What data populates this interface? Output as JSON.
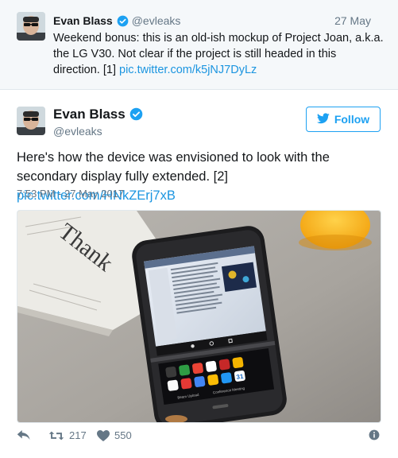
{
  "parent_tweet": {
    "name": "Evan Blass",
    "handle": "@evleaks",
    "date": "27 May",
    "text": "Weekend bonus: this is an old-ish mockup of Project Joan, a.k.a. the LG V30. Not clear if the project is still headed in this direction. [1] ",
    "link": "pic.twitter.com/k5jNJ7DyLz"
  },
  "main_tweet": {
    "name": "Evan Blass",
    "handle": "@evleaks",
    "follow_label": "Follow",
    "text": "Here's how the device was envisioned to look with the secondary display fully extended. [2] ",
    "link": "pic.twitter.com/HNkZErj7xB",
    "timestamp": "7:53 PM - 27 May 2017"
  },
  "media": {
    "newspaper_text": "Thank",
    "secondary_screen_labels": [
      "Beam Upload",
      "Conference Meeting"
    ],
    "calendar_day": "31"
  },
  "actions": {
    "retweet_count": "217",
    "like_count": "550"
  },
  "icons": [
    "verified-badge-icon",
    "twitter-bird-icon",
    "reply-icon",
    "retweet-icon",
    "heart-icon",
    "info-icon"
  ],
  "colors": {
    "link": "#1b95e0",
    "accent": "#1da1f2",
    "muted": "#657786",
    "header_bg": "#f5f8fa"
  }
}
